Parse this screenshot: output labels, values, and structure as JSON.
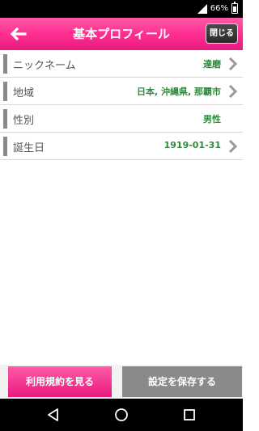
{
  "status_bar": {
    "battery_percent": "66%"
  },
  "header": {
    "title": "基本プロフィール",
    "close_label": "閉じる",
    "accent_color": "#ff2f92"
  },
  "profile": [
    {
      "label": "ニックネーム",
      "value": "達磨",
      "has_chevron": true
    },
    {
      "label": "地域",
      "value": "日本, 沖縄県, 那覇市",
      "has_chevron": true
    },
    {
      "label": "性別",
      "value": "男性",
      "has_chevron": false
    },
    {
      "label": "誕生日",
      "value": "1919-01-31",
      "has_chevron": true
    }
  ],
  "footer": {
    "terms_label": "利用規約を見る",
    "save_label": "設定を保存する"
  },
  "nav_bar": {
    "icons": [
      "back-triangle-icon",
      "home-circle-icon",
      "recents-square-icon"
    ]
  },
  "colors": {
    "value_text": "#2e8b3e",
    "label_bar": "#8a8a8a",
    "save_button": "#8a8a8a"
  }
}
